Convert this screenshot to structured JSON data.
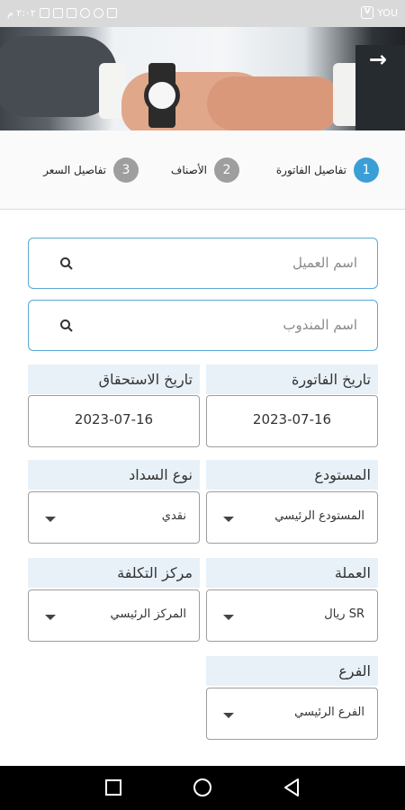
{
  "status_bar": {
    "left_text": "٢:٠٢ م",
    "right_badge": "YOU"
  },
  "header": {
    "back_arrow": "→"
  },
  "stepper": {
    "steps": [
      {
        "number": "1",
        "label": "تفاصيل الفاتورة",
        "active": true
      },
      {
        "number": "2",
        "label": "الأصناف",
        "active": false
      },
      {
        "number": "3",
        "label": "تفاصيل السعر",
        "active": false
      }
    ],
    "active_color": "#3a9fd6",
    "inactive_color": "#9e9e9e"
  },
  "search": {
    "customer_placeholder": "اسم العميل",
    "rep_placeholder": "اسم المندوب",
    "icon": "search-icon"
  },
  "form": {
    "invoice_date": {
      "label": "تاريخ الفاتورة",
      "value": "2023-07-16"
    },
    "due_date": {
      "label": "تاريخ الاستحقاق",
      "value": "2023-07-16"
    },
    "warehouse": {
      "label": "المستودع",
      "value": "المستودع الرئيسي"
    },
    "payment_type": {
      "label": "نوع السداد",
      "value": "نقدي"
    },
    "currency": {
      "label": "العملة",
      "value": "ريال SR"
    },
    "cost_center": {
      "label": "مركز التكلفة",
      "value": "المركز الرئيسي"
    },
    "branch": {
      "label": "الفرع",
      "value": "الفرع الرئيسي"
    }
  },
  "colors": {
    "accent": "#3a9fd6",
    "input_border": "#5aa9d1",
    "label_bg": "#e8f1f8"
  }
}
